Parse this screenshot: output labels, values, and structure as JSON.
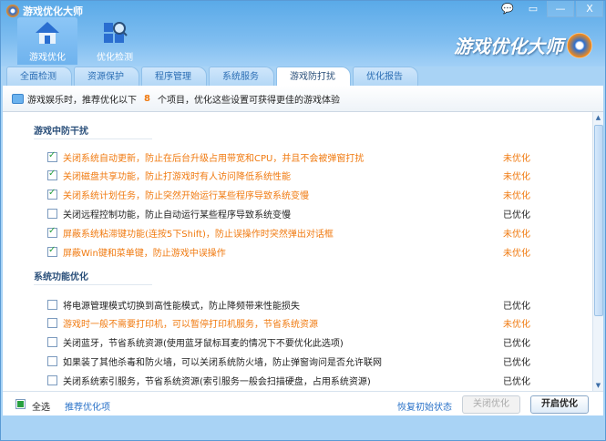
{
  "window": {
    "title": "游戏优化大师",
    "brand": "游戏优化大师",
    "controls": {
      "minimize": "—",
      "close": "X"
    }
  },
  "nav": [
    {
      "label": "游戏优化",
      "active": true
    },
    {
      "label": "优化检测",
      "active": false
    }
  ],
  "tabs": [
    {
      "label": "全面检测"
    },
    {
      "label": "资源保护"
    },
    {
      "label": "程序管理"
    },
    {
      "label": "系统服务"
    },
    {
      "label": "游戏防打扰",
      "active": true
    },
    {
      "label": "优化报告"
    }
  ],
  "info": {
    "prefix": "游戏娱乐时，推荐优化以下",
    "count": "8",
    "suffix": "个项目，优化这些设置可获得更佳的游戏体验"
  },
  "groups": [
    {
      "title": "游戏中防干扰",
      "items": [
        {
          "text": "关闭系统自动更新，防止在后台升级占用带宽和CPU，并且不会被弹窗打扰",
          "checked": true,
          "status": "未优化"
        },
        {
          "text": "关闭磁盘共享功能，防止打游戏时有人访问降低系统性能",
          "checked": true,
          "status": "未优化"
        },
        {
          "text": "关闭系统计划任务，防止突然开始运行某些程序导致系统变慢",
          "checked": true,
          "status": "未优化"
        },
        {
          "text": "关闭远程控制功能，防止自动运行某些程序导致系统变慢",
          "checked": false,
          "status": "已优化"
        },
        {
          "text": "屏蔽系统粘滞键功能(连按5下Shift)，防止误操作时突然弹出对话框",
          "checked": true,
          "status": "未优化"
        },
        {
          "text": "屏蔽Win键和菜单键，防止游戏中误操作",
          "checked": true,
          "status": "未优化"
        }
      ]
    },
    {
      "title": "系统功能优化",
      "items": [
        {
          "text": "将电源管理模式切换到高性能模式，防止降频带来性能损失",
          "checked": false,
          "status": "已优化"
        },
        {
          "text": "游戏时一般不需要打印机，可以暂停打印机服务，节省系统资源",
          "checked": false,
          "status": "未优化"
        },
        {
          "text": "关闭蓝牙，节省系统资源(使用蓝牙鼠标耳麦的情况下不要优化此选项)",
          "checked": false,
          "status": "已优化"
        },
        {
          "text": "如果装了其他杀毒和防火墙，可以关闭系统防火墙，防止弹窗询问是否允许联网",
          "checked": false,
          "status": "已优化"
        },
        {
          "text": "关闭系统索引服务，节省系统资源(索引服务一般会扫描硬盘，占用系统资源)",
          "checked": false,
          "status": "已优化"
        }
      ]
    }
  ],
  "footer": {
    "select_all": "全选",
    "recommend": "推荐优化项",
    "restore": "恢复初始状态",
    "close_opt": "关闭优化",
    "start_opt": "开启优化"
  }
}
